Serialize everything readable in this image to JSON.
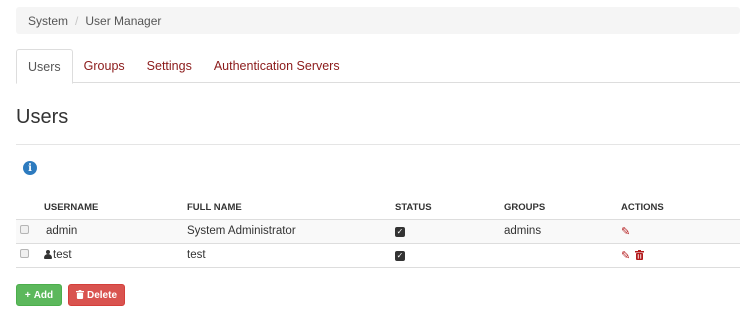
{
  "breadcrumb": {
    "items": [
      "System",
      "User Manager"
    ],
    "separator": "/"
  },
  "tabs": [
    {
      "label": "Users",
      "active": true
    },
    {
      "label": "Groups",
      "active": false
    },
    {
      "label": "Settings",
      "active": false
    },
    {
      "label": "Authentication Servers",
      "active": false
    }
  ],
  "page": {
    "title": "Users",
    "info_icon": "info-circle-icon"
  },
  "table": {
    "headers": [
      "USERNAME",
      "FULL NAME",
      "STATUS",
      "GROUPS",
      "ACTIONS"
    ],
    "rows": [
      {
        "username": "admin",
        "user_icon": false,
        "full_name": "System Administrator",
        "status_checked": true,
        "groups": "admins",
        "actions": [
          "pencil-icon"
        ]
      },
      {
        "username": "test",
        "user_icon": true,
        "full_name": "test",
        "status_checked": true,
        "groups": "",
        "actions": [
          "pencil-icon",
          "trash-icon"
        ]
      }
    ]
  },
  "buttons": {
    "add_label": "Add",
    "delete_label": "Delete"
  },
  "colors": {
    "link": "#8b1a1a",
    "add": "#5cb85c",
    "delete": "#d9534f",
    "action_icon": "#b3191b",
    "info": "#2d7bbf"
  }
}
